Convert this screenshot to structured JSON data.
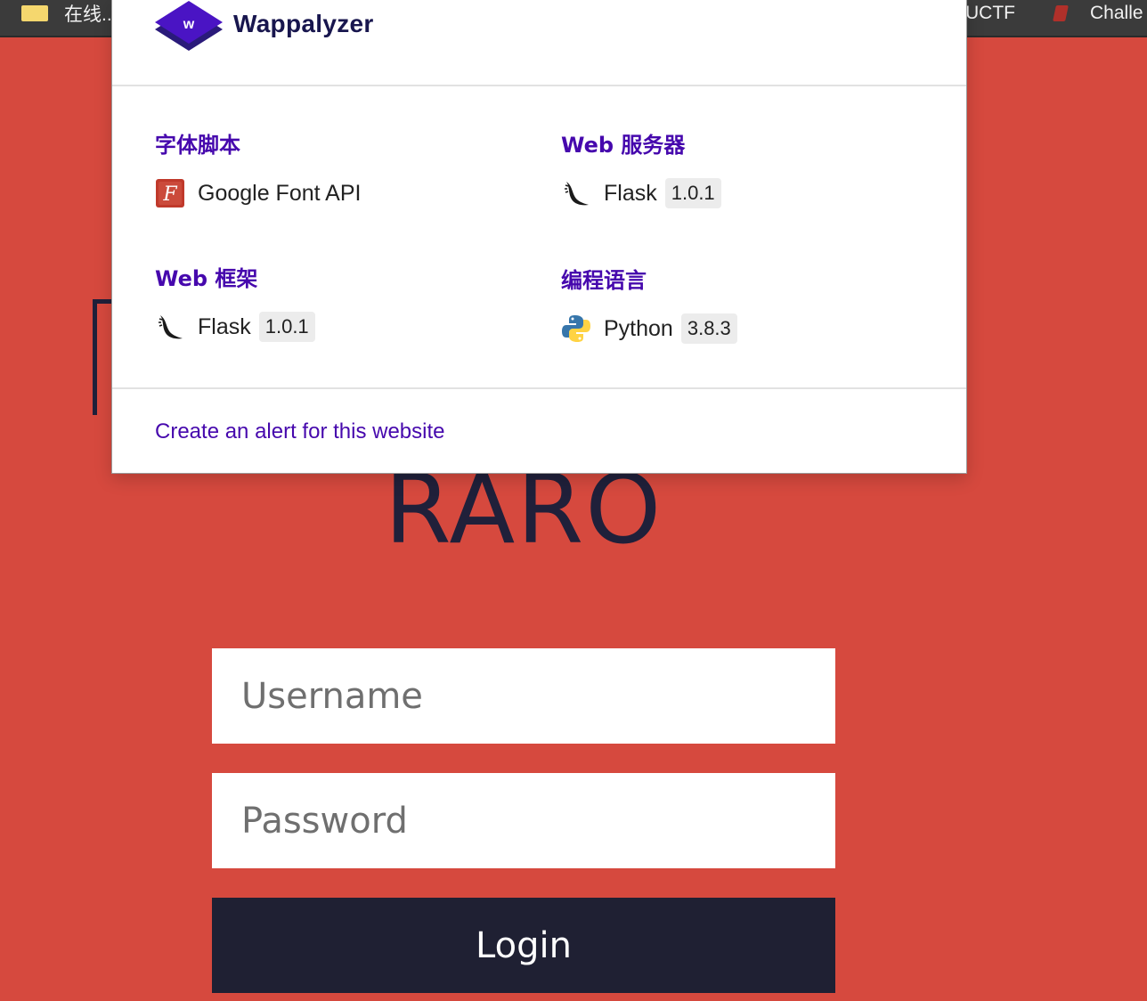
{
  "bookmarks": [
    {
      "label": "在线..."
    },
    {
      "label": "UCTF"
    },
    {
      "label": "Challe"
    }
  ],
  "page": {
    "heading": "RARO",
    "username_placeholder": "Username",
    "password_placeholder": "Password",
    "login_label": "Login"
  },
  "wappalyzer": {
    "logo_text": "Wappalyzer",
    "logo_letter": "w",
    "categories": [
      {
        "title": "字体脚本",
        "tech": {
          "name": "Google Font API",
          "version": ""
        }
      },
      {
        "title": "Web 服务器",
        "tech": {
          "name": "Flask",
          "version": "1.0.1"
        }
      },
      {
        "title": "Web 框架",
        "tech": {
          "name": "Flask",
          "version": "1.0.1"
        }
      },
      {
        "title": "编程语言",
        "tech": {
          "name": "Python",
          "version": "3.8.3"
        }
      }
    ],
    "alert_link": "Create an alert for this website"
  },
  "colors": {
    "background": "#d6493e",
    "accent": "#4608ad",
    "button": "#1f2033"
  },
  "icons": {
    "google_font": "google-font-api-icon",
    "flask": "flask-icon",
    "python": "python-icon"
  }
}
